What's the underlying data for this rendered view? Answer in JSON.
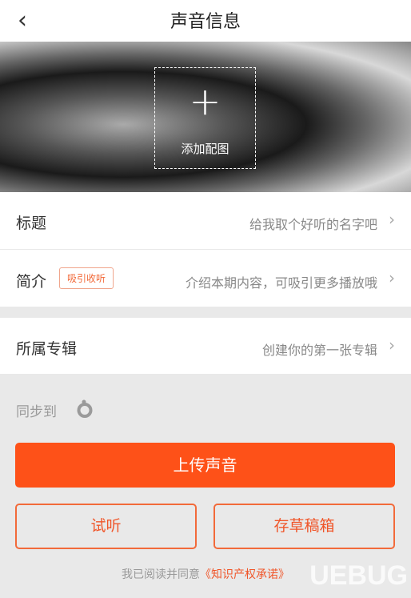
{
  "header": {
    "title": "声音信息",
    "back_icon": "chevron-left-icon"
  },
  "cover": {
    "add_label": "添加配图",
    "plus_icon": "plus-icon"
  },
  "rows": [
    {
      "label": "标题",
      "value": "给我取个好听的名字吧"
    },
    {
      "label": "简介",
      "tag": "吸引收听",
      "value": "介绍本期内容，可吸引更多播放哦"
    },
    {
      "label": "所属专辑",
      "value": "创建你的第一张专辑"
    }
  ],
  "sync": {
    "label": "同步到",
    "icon": "sync-platform-icon"
  },
  "buttons": {
    "upload": "上传声音",
    "preview": "试听",
    "draft": "存草稿箱"
  },
  "footer": {
    "text": "我已阅读并同意",
    "link": "《知识产权承诺》"
  },
  "watermark": "UEBUG.com 下载站",
  "colors": {
    "accent": "#fe5118",
    "background": "#e9e9e9"
  }
}
